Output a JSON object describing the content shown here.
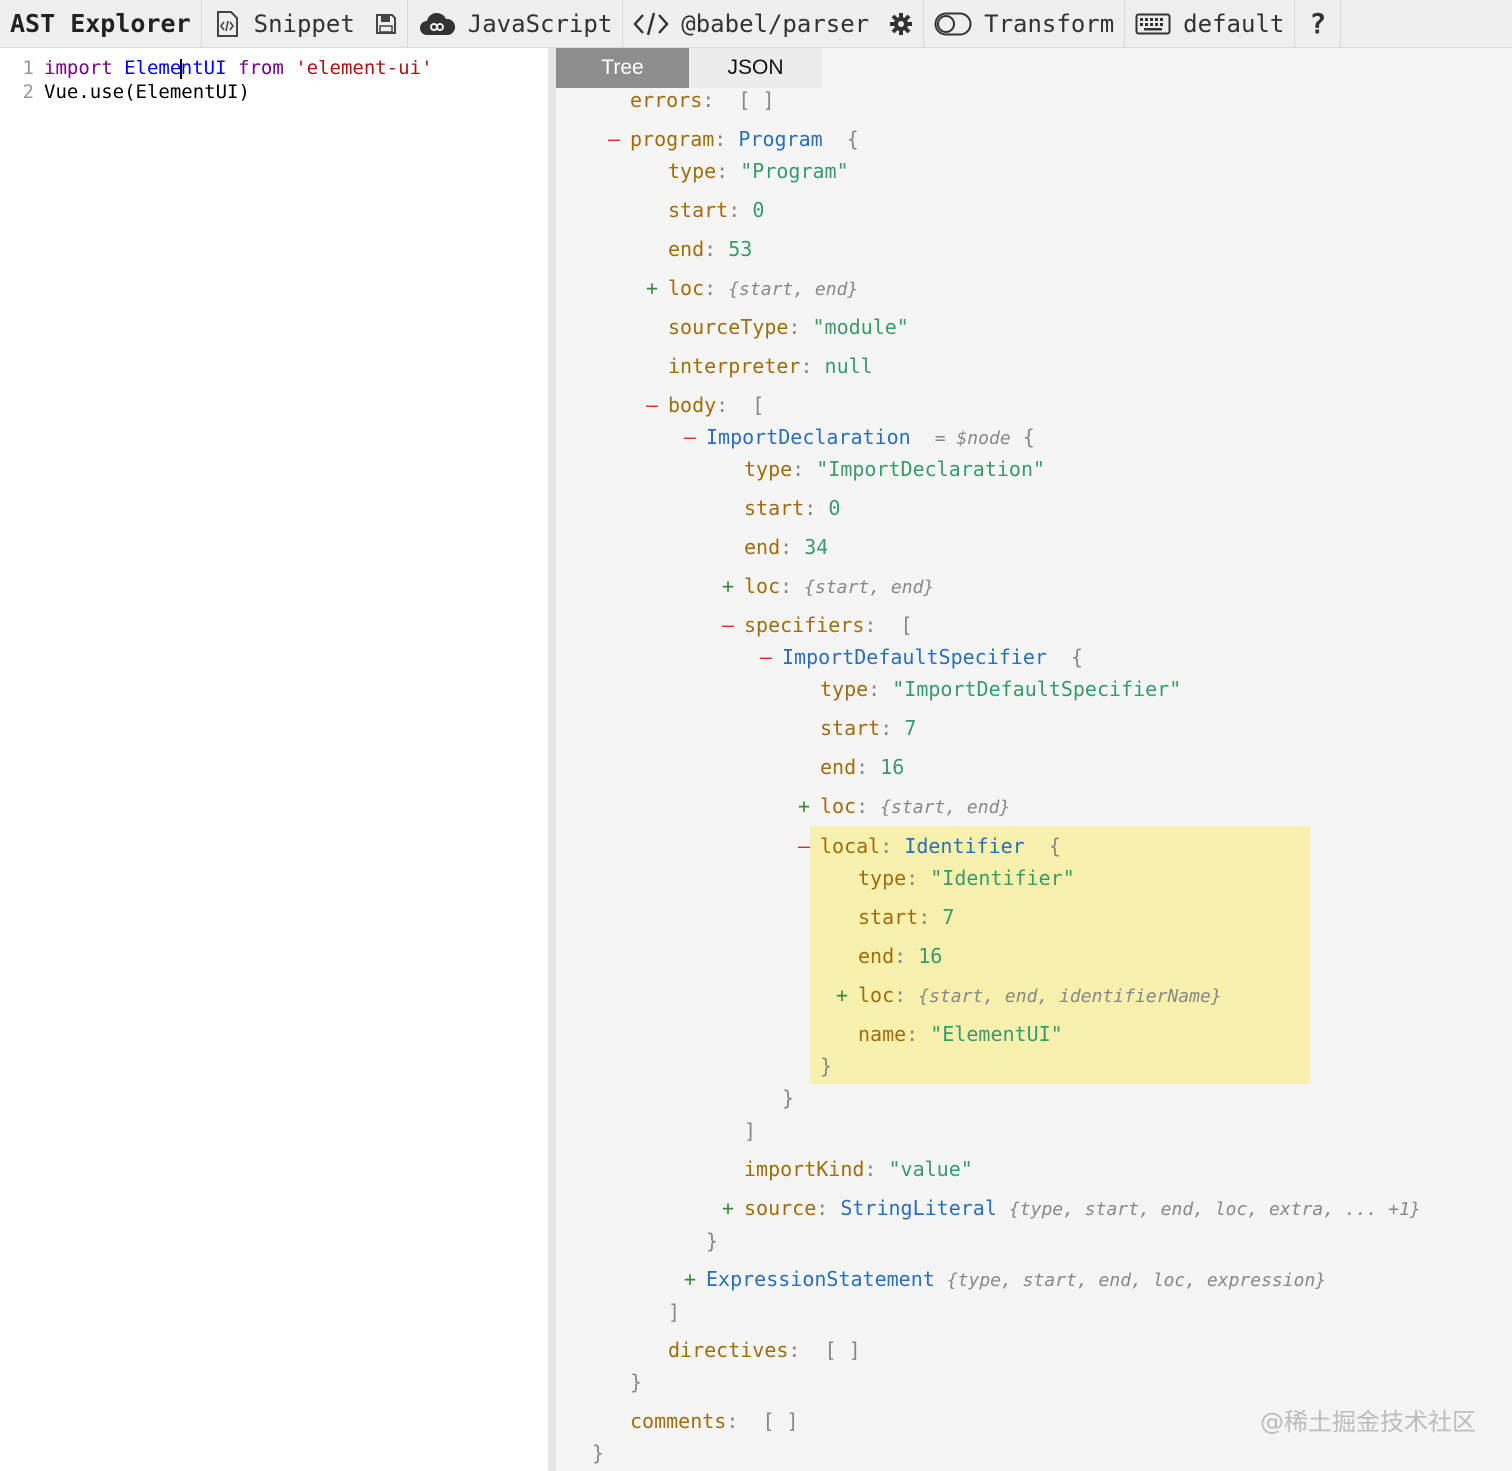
{
  "toolbar": {
    "title": "AST Explorer",
    "snippet": "Snippet",
    "language": "JavaScript",
    "parser": "@babel/parser",
    "transform": "Transform",
    "keymap": "default",
    "help": "?"
  },
  "editor": {
    "lines": [
      {
        "num": "1",
        "tokens": [
          [
            "kw",
            "import"
          ],
          [
            "sp",
            " "
          ],
          [
            "var",
            "Eleme"
          ],
          [
            "cur",
            ""
          ],
          [
            "var",
            "ntUI"
          ],
          [
            "sp",
            " "
          ],
          [
            "kw",
            "from"
          ],
          [
            "sp",
            " "
          ],
          [
            "str",
            "'element-ui'"
          ]
        ]
      },
      {
        "num": "2",
        "tokens": [
          [
            "plain",
            "Vue.use(ElementUI)"
          ]
        ]
      }
    ]
  },
  "tabs": {
    "tree": "Tree",
    "json": "JSON"
  },
  "tree": [
    {
      "indent": 0,
      "toggle": "",
      "parts": [
        [
          "k",
          "errors"
        ],
        [
          "p",
          ":  [ ]"
        ]
      ]
    },
    {
      "indent": 0,
      "toggle": "-",
      "parts": [
        [
          "k",
          "program"
        ],
        [
          "p",
          ": "
        ],
        [
          "t",
          "Program"
        ],
        [
          "p",
          "  {"
        ]
      ]
    },
    {
      "indent": 1,
      "toggle": "",
      "parts": [
        [
          "k",
          "type"
        ],
        [
          "p",
          ": "
        ],
        [
          "s",
          "\"Program\""
        ]
      ]
    },
    {
      "indent": 1,
      "toggle": "",
      "parts": [
        [
          "k",
          "start"
        ],
        [
          "p",
          ": "
        ],
        [
          "n",
          "0"
        ]
      ]
    },
    {
      "indent": 1,
      "toggle": "",
      "parts": [
        [
          "k",
          "end"
        ],
        [
          "p",
          ": "
        ],
        [
          "n",
          "53"
        ]
      ]
    },
    {
      "indent": 1,
      "toggle": "+",
      "parts": [
        [
          "k",
          "loc"
        ],
        [
          "p",
          ": "
        ],
        [
          "i",
          "{start, end}"
        ]
      ]
    },
    {
      "indent": 1,
      "toggle": "",
      "parts": [
        [
          "k",
          "sourceType"
        ],
        [
          "p",
          ": "
        ],
        [
          "s",
          "\"module\""
        ]
      ]
    },
    {
      "indent": 1,
      "toggle": "",
      "parts": [
        [
          "k",
          "interpreter"
        ],
        [
          "p",
          ": "
        ],
        [
          "n",
          "null"
        ]
      ]
    },
    {
      "indent": 1,
      "toggle": "-",
      "parts": [
        [
          "k",
          "body"
        ],
        [
          "p",
          ":  ["
        ]
      ]
    },
    {
      "indent": 2,
      "toggle": "-",
      "parts": [
        [
          "t",
          "ImportDeclaration"
        ],
        [
          "p",
          "  "
        ],
        [
          "i",
          "= $node"
        ],
        [
          "p",
          " {"
        ]
      ]
    },
    {
      "indent": 3,
      "toggle": "",
      "parts": [
        [
          "k",
          "type"
        ],
        [
          "p",
          ": "
        ],
        [
          "s",
          "\"ImportDeclaration\""
        ]
      ]
    },
    {
      "indent": 3,
      "toggle": "",
      "parts": [
        [
          "k",
          "start"
        ],
        [
          "p",
          ": "
        ],
        [
          "n",
          "0"
        ]
      ]
    },
    {
      "indent": 3,
      "toggle": "",
      "parts": [
        [
          "k",
          "end"
        ],
        [
          "p",
          ": "
        ],
        [
          "n",
          "34"
        ]
      ]
    },
    {
      "indent": 3,
      "toggle": "+",
      "parts": [
        [
          "k",
          "loc"
        ],
        [
          "p",
          ": "
        ],
        [
          "i",
          "{start, end}"
        ]
      ]
    },
    {
      "indent": 3,
      "toggle": "-",
      "parts": [
        [
          "k",
          "specifiers"
        ],
        [
          "p",
          ":  ["
        ]
      ]
    },
    {
      "indent": 4,
      "toggle": "-",
      "parts": [
        [
          "t",
          "ImportDefaultSpecifier"
        ],
        [
          "p",
          "  {"
        ]
      ]
    },
    {
      "indent": 5,
      "toggle": "",
      "parts": [
        [
          "k",
          "type"
        ],
        [
          "p",
          ": "
        ],
        [
          "s",
          "\"ImportDefaultSpecifier\""
        ]
      ]
    },
    {
      "indent": 5,
      "toggle": "",
      "parts": [
        [
          "k",
          "start"
        ],
        [
          "p",
          ": "
        ],
        [
          "n",
          "7"
        ]
      ]
    },
    {
      "indent": 5,
      "toggle": "",
      "parts": [
        [
          "k",
          "end"
        ],
        [
          "p",
          ": "
        ],
        [
          "n",
          "16"
        ]
      ]
    },
    {
      "indent": 5,
      "toggle": "+",
      "parts": [
        [
          "k",
          "loc"
        ],
        [
          "p",
          ": "
        ],
        [
          "i",
          "{start, end}"
        ]
      ]
    },
    {
      "indent": 5,
      "toggle": "-",
      "parts": [
        [
          "k",
          "local"
        ],
        [
          "p",
          ": "
        ],
        [
          "t",
          "Identifier"
        ],
        [
          "p",
          "  {"
        ]
      ]
    },
    {
      "indent": 6,
      "toggle": "",
      "parts": [
        [
          "k",
          "type"
        ],
        [
          "p",
          ": "
        ],
        [
          "s",
          "\"Identifier\""
        ]
      ]
    },
    {
      "indent": 6,
      "toggle": "",
      "parts": [
        [
          "k",
          "start"
        ],
        [
          "p",
          ": "
        ],
        [
          "n",
          "7"
        ]
      ]
    },
    {
      "indent": 6,
      "toggle": "",
      "parts": [
        [
          "k",
          "end"
        ],
        [
          "p",
          ": "
        ],
        [
          "n",
          "16"
        ]
      ]
    },
    {
      "indent": 6,
      "toggle": "+",
      "parts": [
        [
          "k",
          "loc"
        ],
        [
          "p",
          ": "
        ],
        [
          "i",
          "{start, end, identifierName}"
        ]
      ]
    },
    {
      "indent": 6,
      "toggle": "",
      "parts": [
        [
          "k",
          "name"
        ],
        [
          "p",
          ": "
        ],
        [
          "s",
          "\"ElementUI\""
        ]
      ]
    },
    {
      "indent": 5,
      "toggle": "",
      "parts": [
        [
          "p",
          "}"
        ]
      ]
    },
    {
      "indent": 4,
      "toggle": "",
      "parts": [
        [
          "p",
          "}"
        ]
      ]
    },
    {
      "indent": 3,
      "toggle": "",
      "parts": [
        [
          "p",
          "]"
        ]
      ]
    },
    {
      "indent": 3,
      "toggle": "",
      "parts": [
        [
          "k",
          "importKind"
        ],
        [
          "p",
          ": "
        ],
        [
          "s",
          "\"value\""
        ]
      ]
    },
    {
      "indent": 3,
      "toggle": "+",
      "parts": [
        [
          "k",
          "source"
        ],
        [
          "p",
          ": "
        ],
        [
          "t",
          "StringLiteral"
        ],
        [
          "p",
          " "
        ],
        [
          "i",
          "{type, start, end, loc, extra, ... +1}"
        ]
      ]
    },
    {
      "indent": 2,
      "toggle": "",
      "parts": [
        [
          "p",
          "}"
        ]
      ]
    },
    {
      "indent": 2,
      "toggle": "+",
      "parts": [
        [
          "t",
          "ExpressionStatement"
        ],
        [
          "p",
          " "
        ],
        [
          "i",
          "{type, start, end, loc, expression}"
        ]
      ]
    },
    {
      "indent": 1,
      "toggle": "",
      "parts": [
        [
          "p",
          "]"
        ]
      ]
    },
    {
      "indent": 1,
      "toggle": "",
      "parts": [
        [
          "k",
          "directives"
        ],
        [
          "p",
          ":  [ ]"
        ]
      ]
    },
    {
      "indent": 0,
      "toggle": "",
      "parts": [
        [
          "p",
          "}"
        ]
      ]
    },
    {
      "indent": 0,
      "toggle": "",
      "parts": [
        [
          "k",
          "comments"
        ],
        [
          "p",
          ":  [ ]"
        ]
      ]
    },
    {
      "indent": -1,
      "toggle": "",
      "parts": [
        [
          "p",
          "}"
        ]
      ]
    }
  ],
  "watermark": "@稀土掘金技术社区"
}
